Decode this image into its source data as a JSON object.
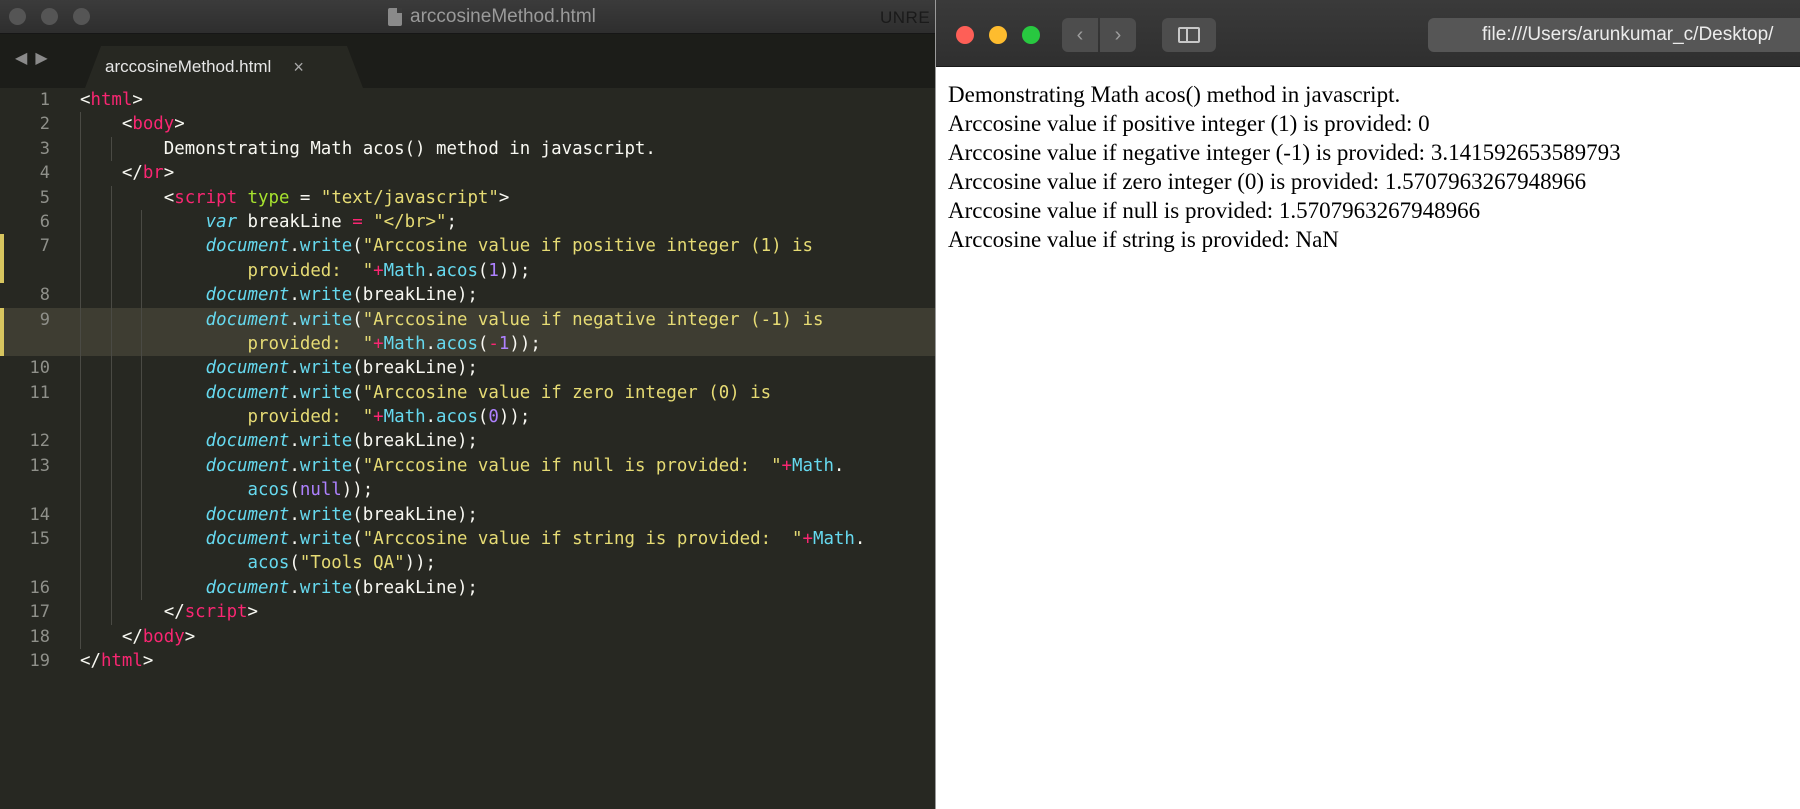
{
  "editor": {
    "window_title": "arccosineMethod.html",
    "unregistered": "UNRE",
    "nav_back": "◀",
    "nav_fwd": "▶",
    "tab_label": "arccosineMethod.html",
    "tab_close": "×",
    "lines": [
      {
        "n": "1",
        "mark": false,
        "active": false,
        "guides": [],
        "rows": [
          [
            {
              "c": "p",
              "t": "<"
            },
            {
              "c": "t",
              "t": "html"
            },
            {
              "c": "p",
              "t": ">"
            }
          ]
        ]
      },
      {
        "n": "2",
        "mark": false,
        "active": false,
        "guides": [
          1
        ],
        "rows": [
          [
            {
              "c": "p",
              "t": "    <"
            },
            {
              "c": "t",
              "t": "body"
            },
            {
              "c": "p",
              "t": ">"
            }
          ]
        ]
      },
      {
        "n": "3",
        "mark": false,
        "active": false,
        "guides": [
          1,
          2
        ],
        "rows": [
          [
            {
              "c": "p",
              "t": "        Demonstrating Math acos() method in javascript."
            }
          ]
        ]
      },
      {
        "n": "4",
        "mark": false,
        "active": false,
        "guides": [
          1
        ],
        "rows": [
          [
            {
              "c": "p",
              "t": "    </"
            },
            {
              "c": "t",
              "t": "br"
            },
            {
              "c": "p",
              "t": ">"
            }
          ]
        ]
      },
      {
        "n": "5",
        "mark": false,
        "active": false,
        "guides": [
          1,
          2
        ],
        "rows": [
          [
            {
              "c": "p",
              "t": "        <"
            },
            {
              "c": "t",
              "t": "script"
            },
            {
              "c": "p",
              "t": " "
            },
            {
              "c": "a",
              "t": "type"
            },
            {
              "c": "p",
              "t": " = "
            },
            {
              "c": "s",
              "t": "\"text/javascript\""
            },
            {
              "c": "p",
              "t": ">"
            }
          ]
        ]
      },
      {
        "n": "6",
        "mark": false,
        "active": false,
        "guides": [
          1,
          2,
          3
        ],
        "rows": [
          [
            {
              "c": "p",
              "t": "            "
            },
            {
              "c": "k",
              "t": "var"
            },
            {
              "c": "p",
              "t": " breakLine "
            },
            {
              "c": "o",
              "t": "="
            },
            {
              "c": "p",
              "t": " "
            },
            {
              "c": "s",
              "t": "\"</br>\""
            },
            {
              "c": "p",
              "t": ";"
            }
          ]
        ]
      },
      {
        "n": "7",
        "mark": true,
        "active": false,
        "guides": [
          1,
          2,
          3
        ],
        "rows": [
          [
            {
              "c": "p",
              "t": "            "
            },
            {
              "c": "k",
              "t": "document"
            },
            {
              "c": "p",
              "t": "."
            },
            {
              "c": "f",
              "t": "write"
            },
            {
              "c": "p",
              "t": "("
            },
            {
              "c": "s",
              "t": "\"Arccosine value if positive integer (1) is"
            }
          ],
          [
            {
              "c": "s",
              "t": "                provided:  \""
            },
            {
              "c": "o",
              "t": "+"
            },
            {
              "c": "f",
              "t": "Math"
            },
            {
              "c": "p",
              "t": "."
            },
            {
              "c": "f",
              "t": "acos"
            },
            {
              "c": "p",
              "t": "("
            },
            {
              "c": "n",
              "t": "1"
            },
            {
              "c": "p",
              "t": "));"
            }
          ]
        ]
      },
      {
        "n": "8",
        "mark": false,
        "active": false,
        "guides": [
          1,
          2,
          3
        ],
        "rows": [
          [
            {
              "c": "p",
              "t": "            "
            },
            {
              "c": "k",
              "t": "document"
            },
            {
              "c": "p",
              "t": "."
            },
            {
              "c": "f",
              "t": "write"
            },
            {
              "c": "p",
              "t": "(breakLine);"
            }
          ]
        ]
      },
      {
        "n": "9",
        "mark": true,
        "active": true,
        "guides": [
          1,
          2,
          3
        ],
        "rows": [
          [
            {
              "c": "p",
              "t": "            "
            },
            {
              "c": "k",
              "t": "document"
            },
            {
              "c": "p",
              "t": "."
            },
            {
              "c": "f",
              "t": "write"
            },
            {
              "c": "p",
              "t": "("
            },
            {
              "c": "s",
              "t": "\"Arccosine value if negative integer (-1) is"
            }
          ],
          [
            {
              "c": "s",
              "t": "                provided:  \""
            },
            {
              "c": "o",
              "t": "+"
            },
            {
              "c": "f",
              "t": "Math"
            },
            {
              "c": "p",
              "t": "."
            },
            {
              "c": "f",
              "t": "acos"
            },
            {
              "c": "p",
              "t": "("
            },
            {
              "c": "o",
              "t": "-"
            },
            {
              "c": "n",
              "t": "1"
            },
            {
              "c": "p",
              "t": "));"
            }
          ]
        ]
      },
      {
        "n": "10",
        "mark": false,
        "active": false,
        "guides": [
          1,
          2,
          3
        ],
        "rows": [
          [
            {
              "c": "p",
              "t": "            "
            },
            {
              "c": "k",
              "t": "document"
            },
            {
              "c": "p",
              "t": "."
            },
            {
              "c": "f",
              "t": "write"
            },
            {
              "c": "p",
              "t": "(breakLine);"
            }
          ]
        ]
      },
      {
        "n": "11",
        "mark": false,
        "active": false,
        "guides": [
          1,
          2,
          3
        ],
        "rows": [
          [
            {
              "c": "p",
              "t": "            "
            },
            {
              "c": "k",
              "t": "document"
            },
            {
              "c": "p",
              "t": "."
            },
            {
              "c": "f",
              "t": "write"
            },
            {
              "c": "p",
              "t": "("
            },
            {
              "c": "s",
              "t": "\"Arccosine value if zero integer (0) is"
            }
          ],
          [
            {
              "c": "s",
              "t": "                provided:  \""
            },
            {
              "c": "o",
              "t": "+"
            },
            {
              "c": "f",
              "t": "Math"
            },
            {
              "c": "p",
              "t": "."
            },
            {
              "c": "f",
              "t": "acos"
            },
            {
              "c": "p",
              "t": "("
            },
            {
              "c": "n",
              "t": "0"
            },
            {
              "c": "p",
              "t": "));"
            }
          ]
        ]
      },
      {
        "n": "12",
        "mark": false,
        "active": false,
        "guides": [
          1,
          2,
          3
        ],
        "rows": [
          [
            {
              "c": "p",
              "t": "            "
            },
            {
              "c": "k",
              "t": "document"
            },
            {
              "c": "p",
              "t": "."
            },
            {
              "c": "f",
              "t": "write"
            },
            {
              "c": "p",
              "t": "(breakLine);"
            }
          ]
        ]
      },
      {
        "n": "13",
        "mark": false,
        "active": false,
        "guides": [
          1,
          2,
          3
        ],
        "rows": [
          [
            {
              "c": "p",
              "t": "            "
            },
            {
              "c": "k",
              "t": "document"
            },
            {
              "c": "p",
              "t": "."
            },
            {
              "c": "f",
              "t": "write"
            },
            {
              "c": "p",
              "t": "("
            },
            {
              "c": "s",
              "t": "\"Arccosine value if null is provided:  \""
            },
            {
              "c": "o",
              "t": "+"
            },
            {
              "c": "f",
              "t": "Math"
            },
            {
              "c": "p",
              "t": "."
            }
          ],
          [
            {
              "c": "f",
              "t": "                acos"
            },
            {
              "c": "p",
              "t": "("
            },
            {
              "c": "n",
              "t": "null"
            },
            {
              "c": "p",
              "t": "));"
            }
          ]
        ]
      },
      {
        "n": "14",
        "mark": false,
        "active": false,
        "guides": [
          1,
          2,
          3
        ],
        "rows": [
          [
            {
              "c": "p",
              "t": "            "
            },
            {
              "c": "k",
              "t": "document"
            },
            {
              "c": "p",
              "t": "."
            },
            {
              "c": "f",
              "t": "write"
            },
            {
              "c": "p",
              "t": "(breakLine);"
            }
          ]
        ]
      },
      {
        "n": "15",
        "mark": false,
        "active": false,
        "guides": [
          1,
          2,
          3
        ],
        "rows": [
          [
            {
              "c": "p",
              "t": "            "
            },
            {
              "c": "k",
              "t": "document"
            },
            {
              "c": "p",
              "t": "."
            },
            {
              "c": "f",
              "t": "write"
            },
            {
              "c": "p",
              "t": "("
            },
            {
              "c": "s",
              "t": "\"Arccosine value if string is provided:  \""
            },
            {
              "c": "o",
              "t": "+"
            },
            {
              "c": "f",
              "t": "Math"
            },
            {
              "c": "p",
              "t": "."
            }
          ],
          [
            {
              "c": "f",
              "t": "                acos"
            },
            {
              "c": "p",
              "t": "("
            },
            {
              "c": "s",
              "t": "\"Tools QA\""
            },
            {
              "c": "p",
              "t": "));"
            }
          ]
        ]
      },
      {
        "n": "16",
        "mark": false,
        "active": false,
        "guides": [
          1,
          2,
          3
        ],
        "rows": [
          [
            {
              "c": "p",
              "t": "            "
            },
            {
              "c": "k",
              "t": "document"
            },
            {
              "c": "p",
              "t": "."
            },
            {
              "c": "f",
              "t": "write"
            },
            {
              "c": "p",
              "t": "(breakLine);"
            }
          ]
        ]
      },
      {
        "n": "17",
        "mark": false,
        "active": false,
        "guides": [
          1,
          2
        ],
        "rows": [
          [
            {
              "c": "p",
              "t": "        </"
            },
            {
              "c": "t",
              "t": "script"
            },
            {
              "c": "p",
              "t": ">"
            }
          ]
        ]
      },
      {
        "n": "18",
        "mark": false,
        "active": false,
        "guides": [
          1
        ],
        "rows": [
          [
            {
              "c": "p",
              "t": "    </"
            },
            {
              "c": "t",
              "t": "body"
            },
            {
              "c": "p",
              "t": ">"
            }
          ]
        ]
      },
      {
        "n": "19",
        "mark": false,
        "active": false,
        "guides": [],
        "rows": [
          [
            {
              "c": "p",
              "t": "</"
            },
            {
              "c": "t",
              "t": "html"
            },
            {
              "c": "p",
              "t": ">"
            }
          ]
        ]
      }
    ]
  },
  "browser": {
    "back_label": "‹",
    "forward_label": "›",
    "url": "file:///Users/arunkumar_c/Desktop/",
    "output_lines": [
      "Demonstrating Math acos() method in javascript.",
      "Arccosine value if positive integer (1) is provided: 0",
      "Arccosine value if negative integer (-1) is provided: 3.141592653589793",
      "Arccosine value if zero integer (0) is provided: 1.5707963267948966",
      "Arccosine value if null is provided: 1.5707963267948966",
      "Arccosine value if string is provided: NaN"
    ]
  },
  "colors": {
    "editor_bg": "#272822",
    "tag": "#f92672",
    "attribute": "#a6e22e",
    "string": "#e6db74",
    "keyword": "#66d9ef",
    "number": "#ae81ff",
    "traffic_red": "#fe5f57",
    "traffic_yellow": "#febc2e",
    "traffic_green": "#28c840"
  }
}
